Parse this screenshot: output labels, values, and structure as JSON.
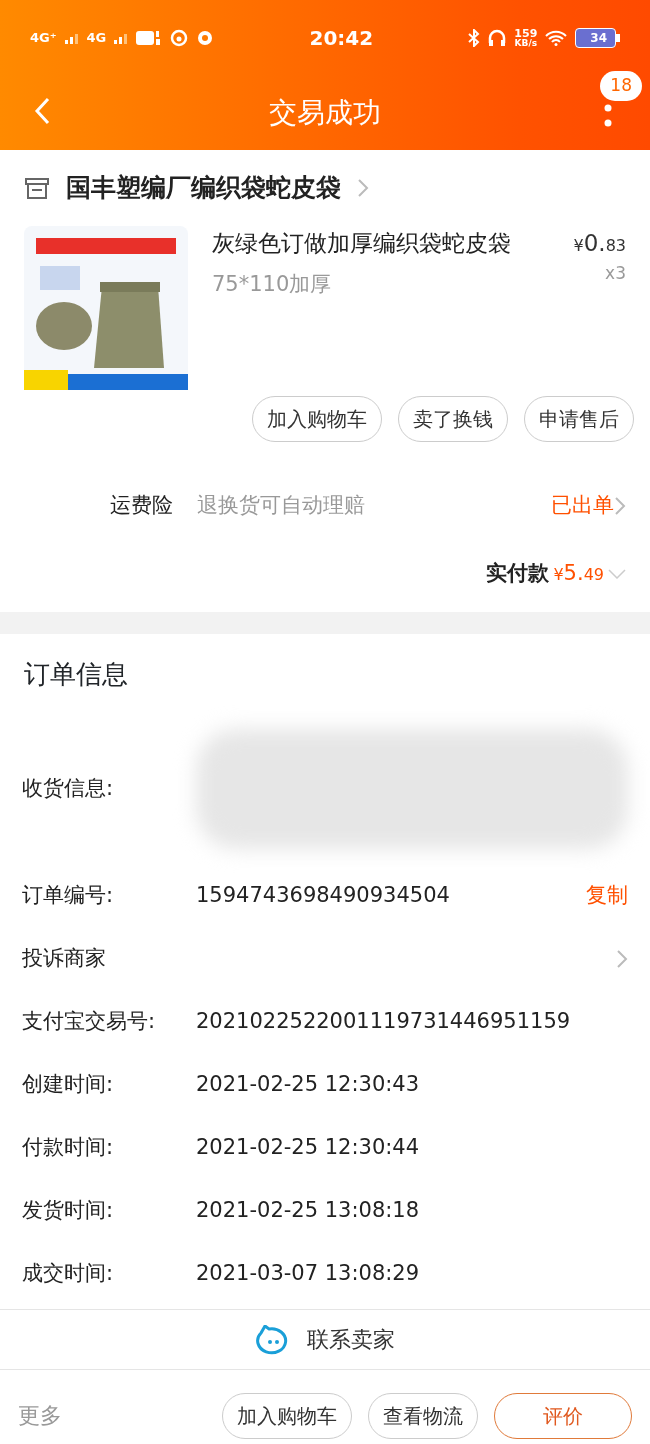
{
  "status_bar": {
    "network_1": "4G⁺",
    "network_2": "4G",
    "time": "20:42",
    "speed": "159",
    "speed_unit": "KB/s",
    "battery": "34"
  },
  "header": {
    "title": "交易成功",
    "badge": "18"
  },
  "shop": {
    "name": "国丰塑编厂编织袋蛇皮袋"
  },
  "item": {
    "title": "灰绿色订做加厚编织袋蛇皮袋",
    "spec": "75*110加厚",
    "currency": "¥",
    "price_int": "0.",
    "price_dec": "83",
    "qty": "x3"
  },
  "item_buttons": [
    "加入购物车",
    "卖了换钱",
    "申请售后"
  ],
  "insurance": {
    "label": "运费险",
    "desc": "退换货可自动理赔",
    "status": "已出单"
  },
  "paid": {
    "label": "实付款",
    "currency": "¥",
    "int": "5.",
    "dec": "49"
  },
  "order_info": {
    "title": "订单信息",
    "rows": [
      {
        "kind": "redacted",
        "label": "收货信息:"
      },
      {
        "kind": "copy",
        "label": "订单编号:",
        "value": "1594743698490934504",
        "action": "复制"
      },
      {
        "kind": "link",
        "label": "投诉商家"
      },
      {
        "kind": "text",
        "label": "支付宝交易号:",
        "value": "2021022522001119731446951159"
      },
      {
        "kind": "text",
        "label": "创建时间:",
        "value": "2021-02-25 12:30:43"
      },
      {
        "kind": "text",
        "label": "付款时间:",
        "value": "2021-02-25 12:30:44"
      },
      {
        "kind": "text",
        "label": "发货时间:",
        "value": "2021-02-25 13:08:18"
      },
      {
        "kind": "text",
        "label": "成交时间:",
        "value": "2021-03-07 13:08:29"
      }
    ]
  },
  "contact": "联系卖家",
  "bottom_bar": {
    "more": "更多",
    "buttons": [
      {
        "label": "加入购物车",
        "primary": false
      },
      {
        "label": "查看物流",
        "primary": false
      },
      {
        "label": "评价",
        "primary": true
      }
    ]
  }
}
